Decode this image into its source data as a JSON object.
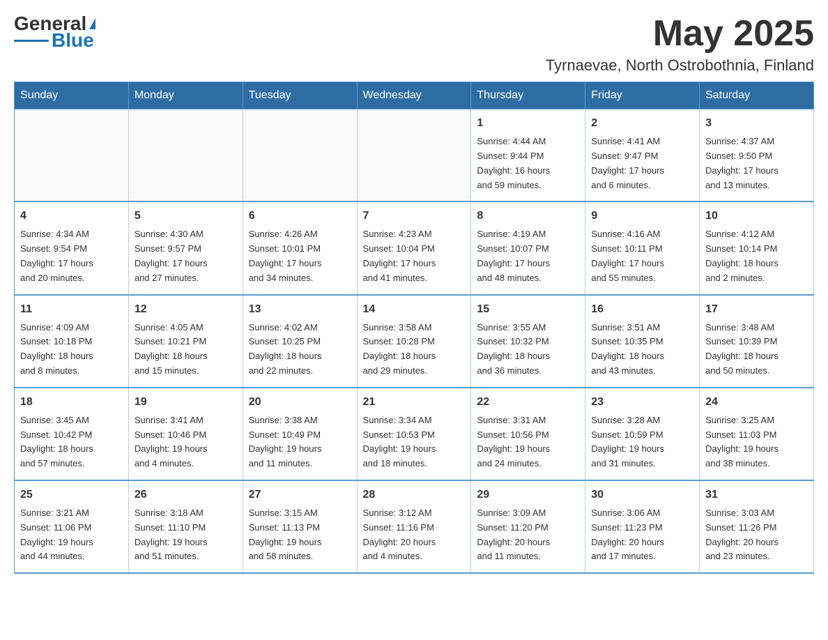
{
  "header": {
    "logo": {
      "text1": "General",
      "text2": "Blue"
    },
    "month": "May 2025",
    "location": "Tyrnaevae, North Ostrobothnia, Finland"
  },
  "days_of_week": [
    "Sunday",
    "Monday",
    "Tuesday",
    "Wednesday",
    "Thursday",
    "Friday",
    "Saturday"
  ],
  "weeks": [
    [
      {
        "day": "",
        "info": ""
      },
      {
        "day": "",
        "info": ""
      },
      {
        "day": "",
        "info": ""
      },
      {
        "day": "",
        "info": ""
      },
      {
        "day": "1",
        "info": "Sunrise: 4:44 AM\nSunset: 9:44 PM\nDaylight: 16 hours\nand 59 minutes."
      },
      {
        "day": "2",
        "info": "Sunrise: 4:41 AM\nSunset: 9:47 PM\nDaylight: 17 hours\nand 6 minutes."
      },
      {
        "day": "3",
        "info": "Sunrise: 4:37 AM\nSunset: 9:50 PM\nDaylight: 17 hours\nand 13 minutes."
      }
    ],
    [
      {
        "day": "4",
        "info": "Sunrise: 4:34 AM\nSunset: 9:54 PM\nDaylight: 17 hours\nand 20 minutes."
      },
      {
        "day": "5",
        "info": "Sunrise: 4:30 AM\nSunset: 9:57 PM\nDaylight: 17 hours\nand 27 minutes."
      },
      {
        "day": "6",
        "info": "Sunrise: 4:26 AM\nSunset: 10:01 PM\nDaylight: 17 hours\nand 34 minutes."
      },
      {
        "day": "7",
        "info": "Sunrise: 4:23 AM\nSunset: 10:04 PM\nDaylight: 17 hours\nand 41 minutes."
      },
      {
        "day": "8",
        "info": "Sunrise: 4:19 AM\nSunset: 10:07 PM\nDaylight: 17 hours\nand 48 minutes."
      },
      {
        "day": "9",
        "info": "Sunrise: 4:16 AM\nSunset: 10:11 PM\nDaylight: 17 hours\nand 55 minutes."
      },
      {
        "day": "10",
        "info": "Sunrise: 4:12 AM\nSunset: 10:14 PM\nDaylight: 18 hours\nand 2 minutes."
      }
    ],
    [
      {
        "day": "11",
        "info": "Sunrise: 4:09 AM\nSunset: 10:18 PM\nDaylight: 18 hours\nand 8 minutes."
      },
      {
        "day": "12",
        "info": "Sunrise: 4:05 AM\nSunset: 10:21 PM\nDaylight: 18 hours\nand 15 minutes."
      },
      {
        "day": "13",
        "info": "Sunrise: 4:02 AM\nSunset: 10:25 PM\nDaylight: 18 hours\nand 22 minutes."
      },
      {
        "day": "14",
        "info": "Sunrise: 3:58 AM\nSunset: 10:28 PM\nDaylight: 18 hours\nand 29 minutes."
      },
      {
        "day": "15",
        "info": "Sunrise: 3:55 AM\nSunset: 10:32 PM\nDaylight: 18 hours\nand 36 minutes."
      },
      {
        "day": "16",
        "info": "Sunrise: 3:51 AM\nSunset: 10:35 PM\nDaylight: 18 hours\nand 43 minutes."
      },
      {
        "day": "17",
        "info": "Sunrise: 3:48 AM\nSunset: 10:39 PM\nDaylight: 18 hours\nand 50 minutes."
      }
    ],
    [
      {
        "day": "18",
        "info": "Sunrise: 3:45 AM\nSunset: 10:42 PM\nDaylight: 18 hours\nand 57 minutes."
      },
      {
        "day": "19",
        "info": "Sunrise: 3:41 AM\nSunset: 10:46 PM\nDaylight: 19 hours\nand 4 minutes."
      },
      {
        "day": "20",
        "info": "Sunrise: 3:38 AM\nSunset: 10:49 PM\nDaylight: 19 hours\nand 11 minutes."
      },
      {
        "day": "21",
        "info": "Sunrise: 3:34 AM\nSunset: 10:53 PM\nDaylight: 19 hours\nand 18 minutes."
      },
      {
        "day": "22",
        "info": "Sunrise: 3:31 AM\nSunset: 10:56 PM\nDaylight: 19 hours\nand 24 minutes."
      },
      {
        "day": "23",
        "info": "Sunrise: 3:28 AM\nSunset: 10:59 PM\nDaylight: 19 hours\nand 31 minutes."
      },
      {
        "day": "24",
        "info": "Sunrise: 3:25 AM\nSunset: 11:03 PM\nDaylight: 19 hours\nand 38 minutes."
      }
    ],
    [
      {
        "day": "25",
        "info": "Sunrise: 3:21 AM\nSunset: 11:06 PM\nDaylight: 19 hours\nand 44 minutes."
      },
      {
        "day": "26",
        "info": "Sunrise: 3:18 AM\nSunset: 11:10 PM\nDaylight: 19 hours\nand 51 minutes."
      },
      {
        "day": "27",
        "info": "Sunrise: 3:15 AM\nSunset: 11:13 PM\nDaylight: 19 hours\nand 58 minutes."
      },
      {
        "day": "28",
        "info": "Sunrise: 3:12 AM\nSunset: 11:16 PM\nDaylight: 20 hours\nand 4 minutes."
      },
      {
        "day": "29",
        "info": "Sunrise: 3:09 AM\nSunset: 11:20 PM\nDaylight: 20 hours\nand 11 minutes."
      },
      {
        "day": "30",
        "info": "Sunrise: 3:06 AM\nSunset: 11:23 PM\nDaylight: 20 hours\nand 17 minutes."
      },
      {
        "day": "31",
        "info": "Sunrise: 3:03 AM\nSunset: 11:26 PM\nDaylight: 20 hours\nand 23 minutes."
      }
    ]
  ]
}
